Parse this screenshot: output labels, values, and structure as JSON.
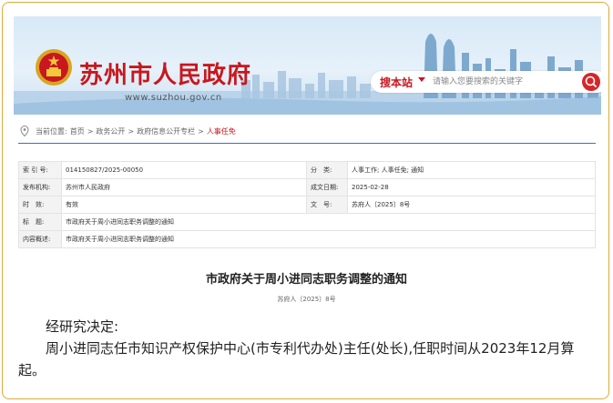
{
  "header": {
    "site_title": "苏州市人民政府",
    "site_url": "www.suzhou.gov.cn",
    "search_label": "搜本站",
    "search_placeholder": "请输入您要搜索的关键字",
    "emblem_icon": "national-emblem-icon",
    "search_icon": "search-icon"
  },
  "breadcrumb": {
    "prefix": "当前位置:",
    "items": [
      "首页",
      "政务公开",
      "政府信息公开专栏",
      "人事任免"
    ],
    "separator": ">"
  },
  "meta_table": {
    "rows": [
      {
        "k1": "索 引 号:",
        "v1": "014150827/2025-00050",
        "k2": "分　类:",
        "v2": "人事工作;  人事任免;  通知"
      },
      {
        "k1": "发布机构:",
        "v1": "苏州市人民政府",
        "k2": "成文日期:",
        "v2": "2025-02-28"
      },
      {
        "k1": "时　效:",
        "v1": "有效",
        "k2": "文　号:",
        "v2": "苏府人〔2025〕8号"
      }
    ],
    "title_label": "标　题:",
    "title_value": "市政府关于周小进同志职务调整的通知",
    "summary_label": "内容概述:",
    "summary_value": "市政府关于周小进同志职务调整的通知"
  },
  "document": {
    "title": "市政府关于周小进同志职务调整的通知",
    "number": "苏府人〔2025〕8号",
    "para1": "经研究决定:",
    "para2": "周小进同志任市知识产权保护中心(市专利代办处)主任(处长),任职时间从2023年12月算起。"
  },
  "colors": {
    "brand_red": "#c8171e",
    "frame_orange": "#e0a93a",
    "divider_blue": "#3d6fc0"
  }
}
